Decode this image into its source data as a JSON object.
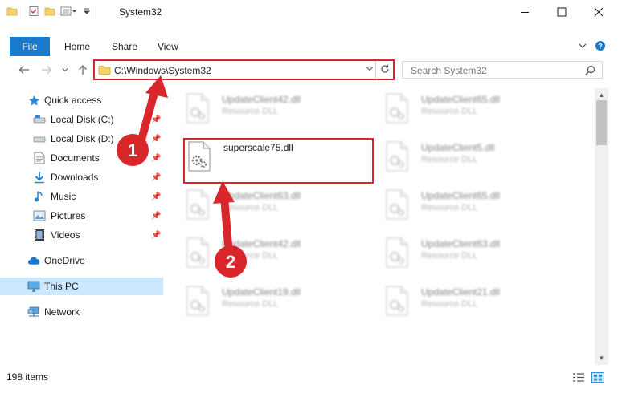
{
  "window": {
    "title": "System32",
    "minimize_icon": "minimize-icon",
    "maximize_icon": "maximize-icon",
    "close_icon": "close-icon"
  },
  "ribbon": {
    "tabs": [
      {
        "label": "File",
        "active": true
      },
      {
        "label": "Home"
      },
      {
        "label": "Share"
      },
      {
        "label": "View"
      }
    ],
    "help_icon": "help-icon",
    "expand_icon": "chevron-down-icon",
    "accent": "#1979ca"
  },
  "address_bar": {
    "path": "C:\\Windows\\System32",
    "search_placeholder": "Search System32"
  },
  "sidebar": {
    "items": [
      {
        "label": "Quick access",
        "icon": "star-icon"
      },
      {
        "label": "Local Disk (C:)",
        "icon": "drive-icon",
        "pinned": true
      },
      {
        "label": "Local Disk (D:)",
        "icon": "drive-icon",
        "pinned": true
      },
      {
        "label": "Documents",
        "icon": "documents-icon",
        "pinned": true
      },
      {
        "label": "Downloads",
        "icon": "download-icon",
        "pinned": true
      },
      {
        "label": "Music",
        "icon": "music-icon",
        "pinned": true
      },
      {
        "label": "Pictures",
        "icon": "pictures-icon",
        "pinned": true
      },
      {
        "label": "Videos",
        "icon": "videos-icon",
        "pinned": true
      },
      {
        "label": "OneDrive",
        "icon": "cloud-icon"
      },
      {
        "label": "This PC",
        "icon": "computer-icon",
        "selected": true
      },
      {
        "label": "Network",
        "icon": "network-icon"
      }
    ]
  },
  "files": [
    {
      "name": "UpdateClient42.dll",
      "type": "Resource DLL"
    },
    {
      "name": "UpdateClient65.dll",
      "type": "Resource DLL"
    },
    {
      "name": "superscale75.dll",
      "type": "",
      "highlighted": true
    },
    {
      "name": "UpdateClient5.dll",
      "type": "Resource DLL"
    },
    {
      "name": "UpdateClient63.dll",
      "type": "Resource DLL"
    },
    {
      "name": "UpdateClient65.dll",
      "type": "Resource DLL"
    },
    {
      "name": "UpdateClient42.dll",
      "type": "Resource DLL"
    },
    {
      "name": "UpdateClient63.dll",
      "type": "Resource DLL"
    },
    {
      "name": "UpdateClient19.dll",
      "type": "Resource DLL"
    },
    {
      "name": "UpdateClient21.dll",
      "type": "Resource DLL"
    }
  ],
  "status": {
    "item_count": "198 items"
  },
  "annotations": {
    "step1": "1",
    "step2": "2",
    "color": "#d9262a"
  }
}
